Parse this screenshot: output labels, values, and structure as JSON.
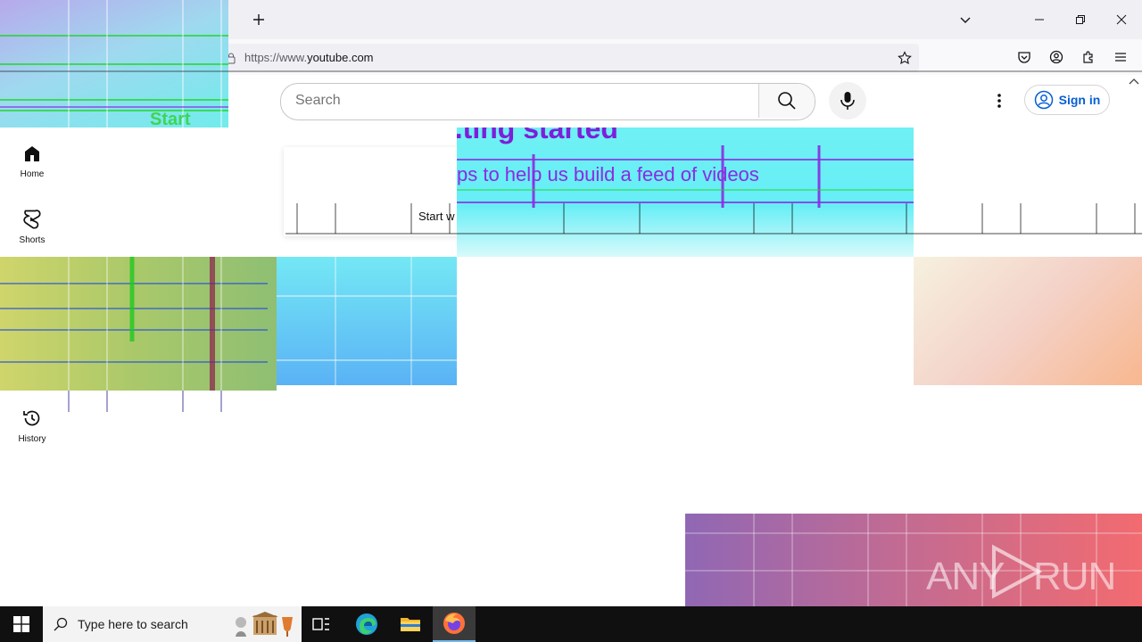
{
  "browser": {
    "new_tab_icon": "plus-icon",
    "tab_list_icon": "chevron-down-icon",
    "window_controls": [
      "minimize-icon",
      "restore-icon",
      "close-icon"
    ],
    "url_prefix": "https://www.",
    "url_host": "youtube.com",
    "toolbar_icons": [
      "bookmark-star-icon",
      "pocket-icon",
      "account-icon",
      "extensions-icon",
      "menu-icon"
    ]
  },
  "youtube": {
    "search_placeholder": "Search",
    "sign_in_label": "Sign in",
    "guide": [
      {
        "label": "Home",
        "icon": "home-icon"
      },
      {
        "label": "Shorts",
        "icon": "shorts-icon"
      },
      {
        "label": "History",
        "icon": "history-icon"
      }
    ],
    "promo": {
      "partial_heading": "...ting started",
      "body_fragment": "ps to help us build a feed of videos",
      "button_fragment": "Start w"
    }
  },
  "taskbar": {
    "search_placeholder": "Type here to search",
    "apps": [
      "task-view-icon",
      "edge-icon",
      "file-explorer-icon",
      "firefox-icon"
    ]
  },
  "watermark": {
    "left": "ANY",
    "right": "RUN"
  },
  "colors": {
    "youtube_blue": "#065fd4",
    "tab_bar": "#f0f0f4",
    "taskbar": "#101010",
    "glitch_cyan": "#6ff0f4",
    "glitch_purple": "#8a2be2"
  }
}
